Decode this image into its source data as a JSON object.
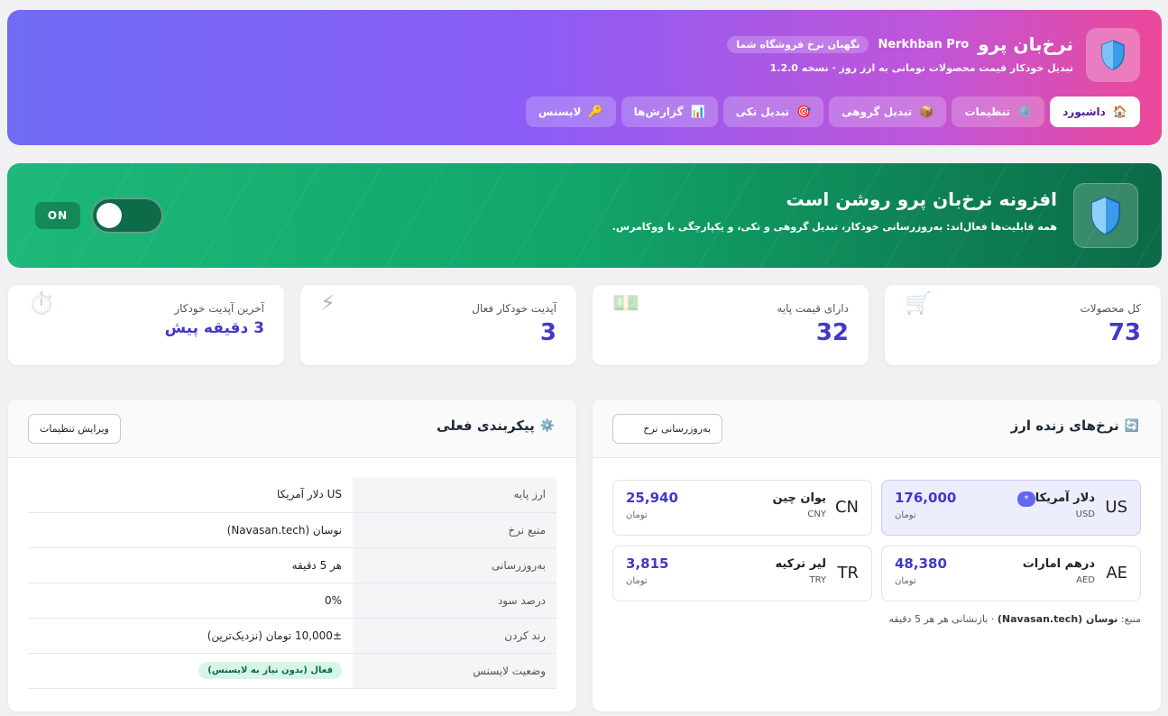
{
  "header": {
    "title": "نرخ‌بان پرو",
    "title_en": "Nerkhban Pro",
    "tagline": "نگهبان نرخ فروشگاه شما",
    "subtitle": "تبدیل خودکار قیمت محصولات تومانی به ارز روز · نسخه 1.2.0",
    "tabs": [
      {
        "label": "داشبورد",
        "icon": "home-icon",
        "active": true
      },
      {
        "label": "تنظیمات",
        "icon": "gear-icon"
      },
      {
        "label": "تبدیل گروهی",
        "icon": "box-icon"
      },
      {
        "label": "تبدیل تکی",
        "icon": "target-icon"
      },
      {
        "label": "گزارش‌ها",
        "icon": "chart-icon"
      },
      {
        "label": "لایسنس",
        "icon": "key-icon"
      }
    ]
  },
  "banner": {
    "title": "افزونه نرخ‌بان پرو روشن است",
    "description": "همه قابلیت‌ها فعال‌اند: به‌روزرسانی خودکار، تبدیل گروهی و تکی، و یکپارچگی با ووکامرس.",
    "state_label": "ON"
  },
  "stats": [
    {
      "label": "کل محصولات",
      "value": "73",
      "icon": "cart-icon"
    },
    {
      "label": "دارای قیمت پایه",
      "value": "32",
      "icon": "money-icon"
    },
    {
      "label": "آپدیت خودکار فعال",
      "value": "3",
      "icon": "lightning-icon"
    },
    {
      "label": "آخرین آپدیت خودکار",
      "value": "3 دقیقه پیش",
      "icon": "stopwatch-icon"
    }
  ],
  "config": {
    "title": "پیکربندی فعلی",
    "edit_button": "ویرایش تنظیمات",
    "rows": [
      {
        "key": "ارز پایه",
        "value": "US دلار آمریکا"
      },
      {
        "key": "منبع نرخ",
        "value": "نوسان (Navasan.tech)"
      },
      {
        "key": "به‌روزرسانی",
        "value": "هر 5 دقیقه"
      },
      {
        "key": "درصد سود",
        "value": "0%"
      },
      {
        "key": "رند کردن",
        "value": "10,000± تومان (نزدیک‌ترین)"
      },
      {
        "key": "وضعیت لایسنس",
        "value": "فعال (بدون نیاز به لایسنس)"
      }
    ]
  },
  "rates": {
    "title": "نرخ‌های زنده ارز",
    "refresh_button": "به‌روزرسانی نرخ",
    "items": [
      {
        "code": "US",
        "name": "دلار آمریکا",
        "currency": "USD",
        "amount": "176,000",
        "unit": "تومان",
        "highlight": true,
        "badge": "*"
      },
      {
        "code": "CN",
        "name": "یوان چین",
        "currency": "CNY",
        "amount": "25,940",
        "unit": "تومان"
      },
      {
        "code": "AE",
        "name": "درهم امارات",
        "currency": "AED",
        "amount": "48,380",
        "unit": "تومان"
      },
      {
        "code": "TR",
        "name": "لیر ترکیه",
        "currency": "TRY",
        "amount": "3,815",
        "unit": "تومان"
      }
    ],
    "source_prefix": "منبع:",
    "source_name": "نوسان (Navasan.tech)",
    "source_suffix": "· بازنشانی هر هر 5 دقیقه"
  }
}
